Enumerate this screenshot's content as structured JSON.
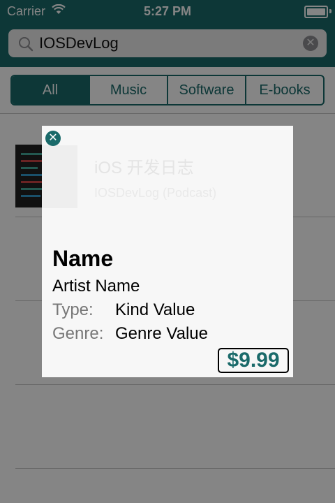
{
  "status_bar": {
    "carrier": "Carrier",
    "time": "5:27 PM"
  },
  "search": {
    "value": "IOSDevLog",
    "placeholder": "",
    "clear_glyph": "✕"
  },
  "segments": [
    "All",
    "Music",
    "Software",
    "E-books"
  ],
  "selected_segment": "All",
  "results": [
    {
      "title": "iOS 开发日志",
      "subtitle": "IOSDevLog (Podcast)"
    }
  ],
  "popup": {
    "close_glyph": "✕",
    "name": "Name",
    "artist": "Artist Name",
    "type_label": "Type:",
    "type_value": "Kind Value",
    "genre_label": "Genre:",
    "genre_value": "Genre Value",
    "price": "$9.99"
  },
  "colors": {
    "accent": "#1a6a6a",
    "overlay": "rgba(0,0,0,0.48)"
  },
  "icons": [
    "wifi-icon",
    "battery-icon",
    "search-icon",
    "clear-icon",
    "close-icon"
  ]
}
